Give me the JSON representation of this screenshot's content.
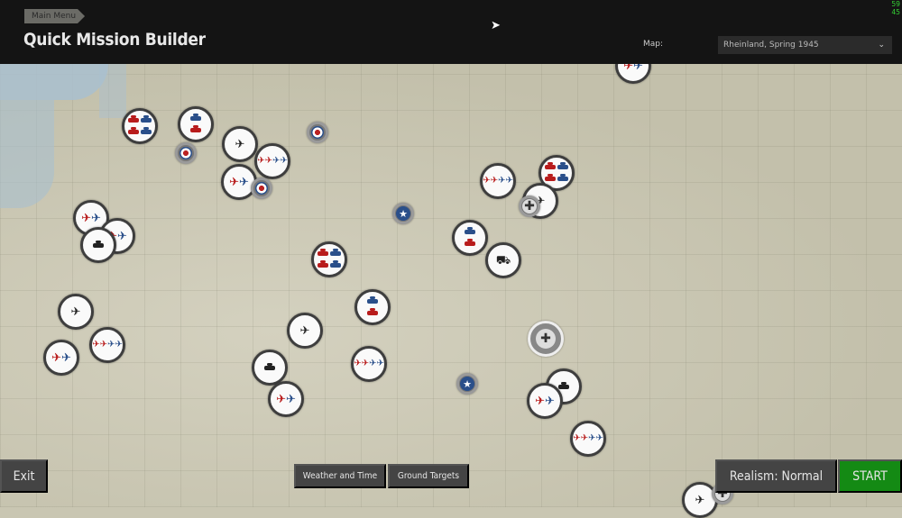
{
  "header": {
    "breadcrumb": "Main Menu",
    "title": "Quick Mission Builder",
    "map_label": "Map:",
    "map_value": "Rheinland, Spring 1945",
    "fps_line1": "59",
    "fps_line2": "45"
  },
  "footer": {
    "exit": "Exit",
    "weather": "Weather and Time",
    "ground_targets": "Ground Targets",
    "realism": "Realism: Normal",
    "start": "START"
  },
  "colors": {
    "start": "#148a14",
    "allied": "#2a4f8a",
    "axis": "#b81c1c",
    "topbar": "#141414"
  },
  "map": {
    "marker_types": [
      "plane-single",
      "plane-pair",
      "plane-group",
      "tank-single",
      "tank-pair",
      "tank-group",
      "truck",
      "airfield-raf-roundel",
      "airfield-us-star",
      "airfield-german-cross"
    ]
  }
}
